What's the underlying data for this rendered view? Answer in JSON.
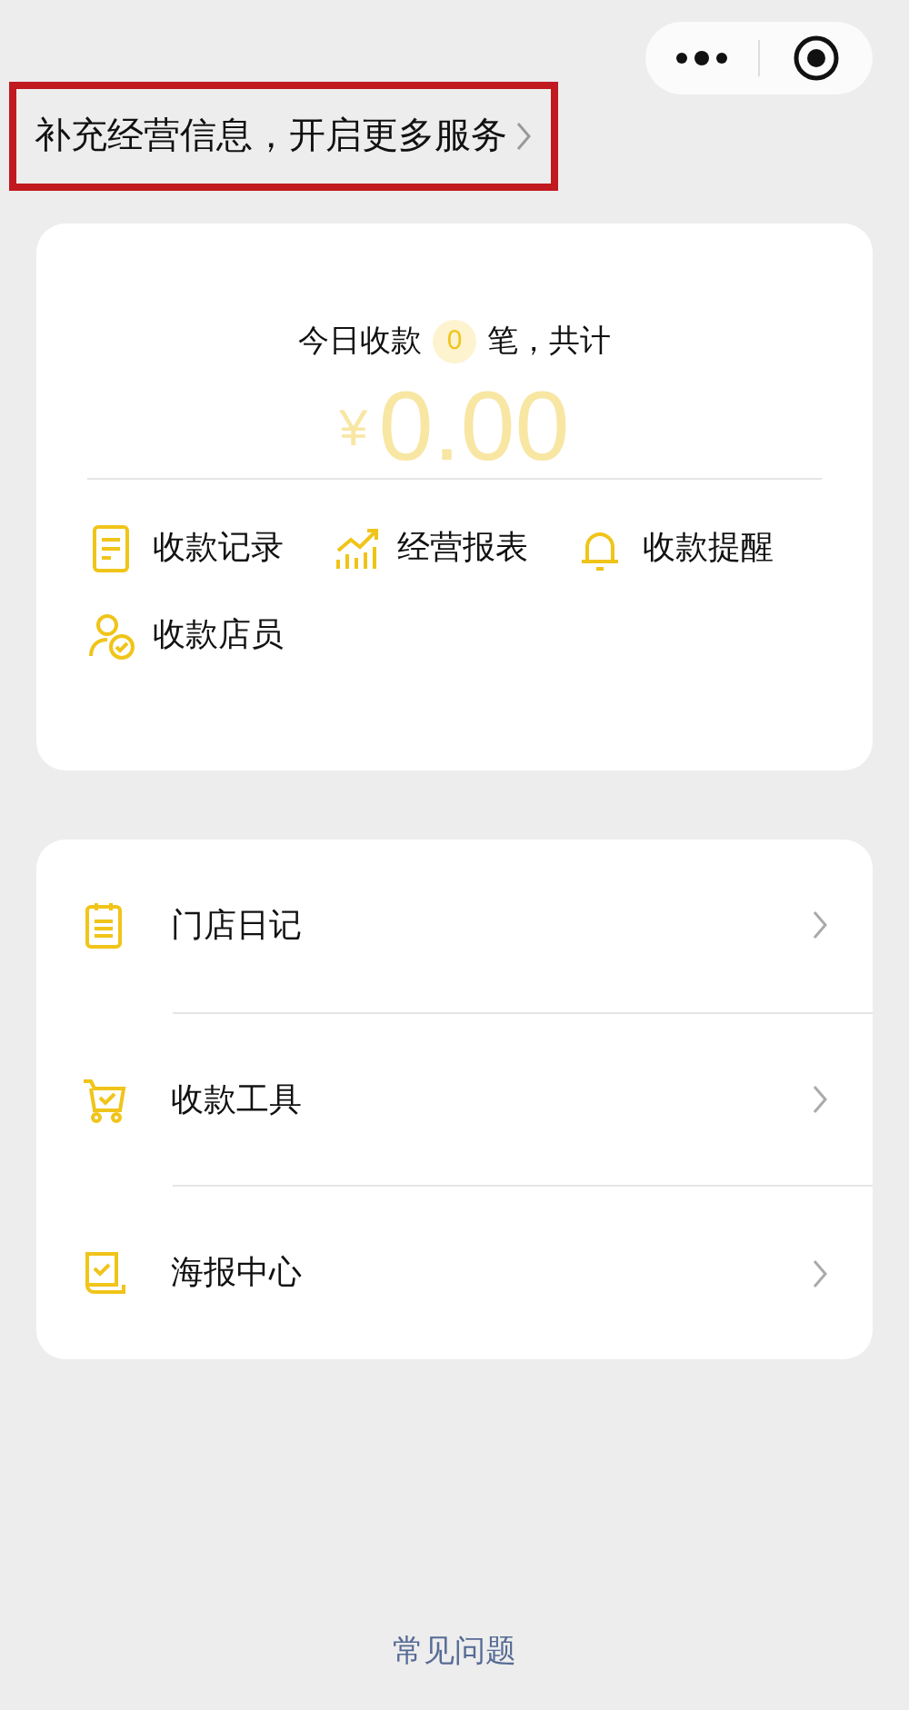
{
  "banner": {
    "text": "补充经营信息，开启更多服务",
    "highlighted": true
  },
  "summary": {
    "prefix": "今日收款",
    "count": "0",
    "suffix": "笔，共计",
    "currency": "¥",
    "amount": "0.00"
  },
  "features": [
    {
      "kind": "record",
      "label": "收款记录"
    },
    {
      "kind": "report",
      "label": "经营报表"
    },
    {
      "kind": "reminder",
      "label": "收款提醒"
    },
    {
      "kind": "staff",
      "label": "收款店员"
    }
  ],
  "menu": [
    {
      "kind": "diary",
      "label": "门店日记"
    },
    {
      "kind": "tools",
      "label": "收款工具"
    },
    {
      "kind": "poster",
      "label": "海报中心"
    }
  ],
  "footer_link": "常见问题"
}
